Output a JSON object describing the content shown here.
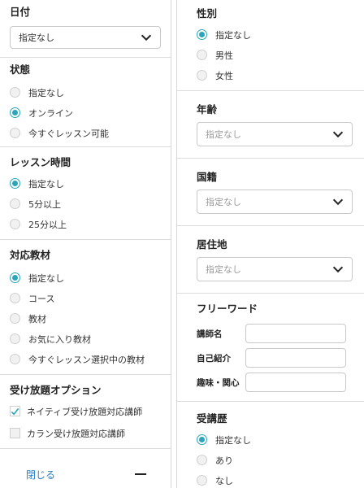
{
  "left": {
    "date": {
      "title": "日付",
      "select_value": "指定なし"
    },
    "status": {
      "title": "状態",
      "options": [
        "指定なし",
        "オンライン",
        "今すぐレッスン可能"
      ],
      "selected": 1
    },
    "lesson_time": {
      "title": "レッスン時間",
      "options": [
        "指定なし",
        "5分以上",
        "25分以上"
      ],
      "selected": 0
    },
    "materials": {
      "title": "対応教材",
      "options": [
        "指定なし",
        "コース",
        "教材",
        "お気に入り教材",
        "今すぐレッスン選択中の教材"
      ],
      "selected": 0
    },
    "unlimited": {
      "title": "受け放題オプション",
      "options": [
        "ネイティブ受け放題対応講師",
        "カラン受け放題対応講師"
      ],
      "checked": [
        true,
        false
      ]
    },
    "footer": {
      "close_label": "閉じる"
    }
  },
  "right": {
    "gender": {
      "title": "性別",
      "options": [
        "指定なし",
        "男性",
        "女性"
      ],
      "selected": 0
    },
    "age": {
      "title": "年齢",
      "select_placeholder": "指定なし"
    },
    "nationality": {
      "title": "国籍",
      "select_placeholder": "指定なし"
    },
    "residence": {
      "title": "居住地",
      "select_placeholder": "指定なし"
    },
    "freeword": {
      "title": "フリーワード",
      "fields": [
        "講師名",
        "自己紹介",
        "趣味・関心"
      ]
    },
    "history": {
      "title": "受講歴",
      "options": [
        "指定なし",
        "あり",
        "なし"
      ],
      "selected": 0
    }
  },
  "colors": {
    "accent": "#2aa6b8",
    "link": "#2a7fc0",
    "divider": "#dcdcdc"
  },
  "icons": [
    "chevron-down-icon",
    "checkmark-icon",
    "minus-icon"
  ]
}
